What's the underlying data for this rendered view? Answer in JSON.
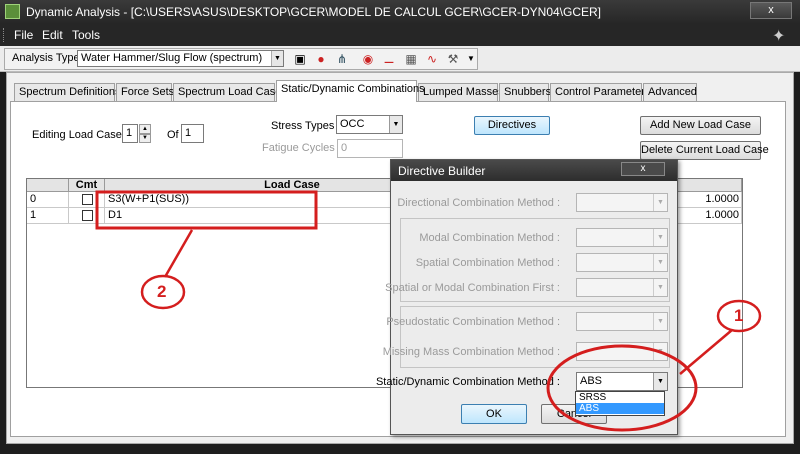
{
  "window": {
    "title": "Dynamic Analysis - [C:\\USERS\\ASUS\\DESKTOP\\GCER\\MODEL DE CALCUL GCER\\GCER-DYN04\\GCER]",
    "close_label": "x"
  },
  "menu": {
    "items": [
      "File",
      "Edit",
      "Tools"
    ]
  },
  "toolbar": {
    "analysis_type_label": "Analysis Type:",
    "analysis_type_value": "Water Hammer/Slug Flow (spectrum)"
  },
  "tabs": [
    "Spectrum Definitions",
    "Force Sets",
    "Spectrum Load Cases",
    "Static/Dynamic Combinations",
    "Lumped Masses",
    "Snubbers",
    "Control Parameters",
    "Advanced"
  ],
  "active_tab": "Static/Dynamic Combinations",
  "form": {
    "editing_label": "Editing Load Case",
    "editing_value": "1",
    "of_label": "Of",
    "of_value": "1",
    "stress_types_label": "Stress Types",
    "stress_types_value": "OCC",
    "fatigue_label": "Fatigue Cycles",
    "fatigue_value": "0",
    "directives_button": "Directives",
    "add_button": "Add New Load Case",
    "delete_button": "Delete Current Load Case"
  },
  "grid": {
    "headers": {
      "cmt": "Cmt",
      "load_case": "Load Case"
    },
    "rows": [
      {
        "index": "0",
        "load_case": "S3(W+P1(SUS))",
        "factor": "1.0000"
      },
      {
        "index": "1",
        "load_case": "D1",
        "factor": "1.0000"
      }
    ]
  },
  "dialog": {
    "title": "Directive Builder",
    "close_label": "x",
    "directional_label": "Directional Combination Method :",
    "modal_label": "Modal Combination Method :",
    "spatial_label": "Spatial Combination Method :",
    "spatial_first_label": "Spatial or Modal Combination First :",
    "pseudostatic_label": "Pseudostatic Combination Method :",
    "missing_mass_label": "Missing Mass Combination Method :",
    "static_dynamic_label": "Static/Dynamic Combination Method :",
    "static_dynamic_value": "ABS",
    "options": [
      "SRSS",
      "ABS"
    ],
    "selected_option": "ABS",
    "ok_button": "OK",
    "cancel_button": "Cancel"
  },
  "annotations": {
    "callout_1": "1",
    "callout_2": "2",
    "color": "#d41e1e"
  }
}
